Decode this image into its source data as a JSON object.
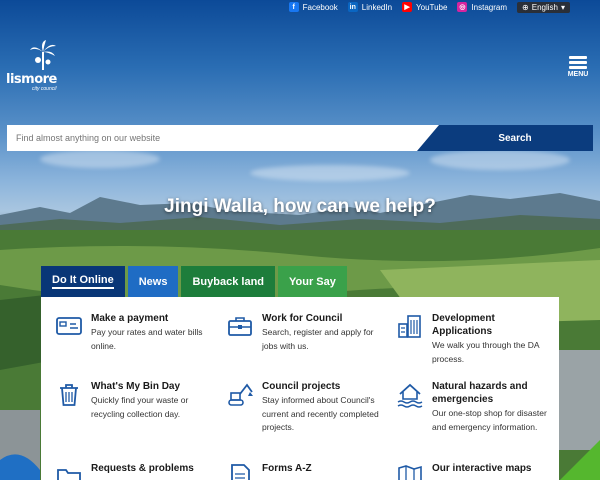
{
  "social": [
    {
      "label": "Facebook",
      "icon": "facebook-icon",
      "color": "#1877f2",
      "glyph": "f"
    },
    {
      "label": "LinkedIn",
      "icon": "linkedin-icon",
      "color": "#0a66c2",
      "glyph": "in"
    },
    {
      "label": "YouTube",
      "icon": "youtube-icon",
      "color": "#ff0000",
      "glyph": "▶"
    },
    {
      "label": "Instagram",
      "icon": "instagram-icon",
      "color": "#d6249f",
      "glyph": "◎"
    }
  ],
  "language": {
    "label": "English"
  },
  "logo": {
    "name": "lismore",
    "sub": "city council"
  },
  "menu": {
    "label": "MENU"
  },
  "search": {
    "placeholder": "Find almost anything on our website",
    "button": "Search"
  },
  "hero": {
    "title": "Jingi Walla, how can we help?"
  },
  "tabs": [
    {
      "label": "Do It Online",
      "active": true
    },
    {
      "label": "News"
    },
    {
      "label": "Buyback land"
    },
    {
      "label": "Your Say"
    }
  ],
  "services": [
    {
      "title": "Make a payment",
      "desc": "Pay your rates and water bills online.",
      "icon": "payment-card-icon"
    },
    {
      "title": "Work for Council",
      "desc": "Search, register and apply for jobs with us.",
      "icon": "briefcase-icon"
    },
    {
      "title": "Development Applications",
      "desc": "We walk you through the DA process.",
      "icon": "buildings-icon"
    },
    {
      "title": "What's My Bin Day",
      "desc": "Quickly find your waste or recycling collection day.",
      "icon": "bin-icon"
    },
    {
      "title": "Council projects",
      "desc": "Stay informed about Council's current and recently completed projects.",
      "icon": "excavator-icon"
    },
    {
      "title": "Natural hazards and emergencies",
      "desc": "Our one-stop shop for disaster and emergency information.",
      "icon": "flood-house-icon"
    },
    {
      "title": "Requests & problems",
      "desc": "",
      "icon": "folder-icon"
    },
    {
      "title": "Forms A-Z",
      "desc": "",
      "icon": "forms-icon"
    },
    {
      "title": "Our interactive maps",
      "desc": "",
      "icon": "map-icon"
    }
  ],
  "colors": {
    "brand": "#0b3c7e",
    "tab_active": "#093677",
    "tab_news": "#1f6cc4",
    "tab_buyback": "#1d7d3b",
    "tab_yoursay": "#3aa14a",
    "icon_blue": "#1f5aa6"
  }
}
